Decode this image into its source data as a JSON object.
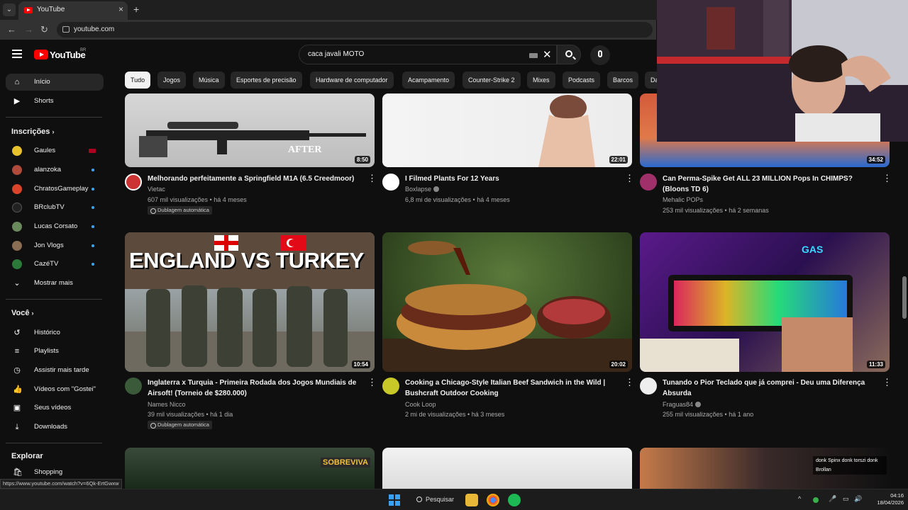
{
  "browser": {
    "tab_title": "YouTube",
    "url": "youtube.com",
    "status_url": "https://www.youtube.com/watch?v=6Qk-ErtGwxw"
  },
  "header": {
    "logo_text": "YouTube",
    "country": "BR",
    "search_value": "caca javali MOTO"
  },
  "sidebar": {
    "main": [
      {
        "label": "Início",
        "icon": "home-icon"
      },
      {
        "label": "Shorts",
        "icon": "shorts-icon"
      }
    ],
    "subs_title": "Inscrições",
    "subs": [
      {
        "label": "Gaules",
        "color": "#e8c22b"
      },
      {
        "label": "alanzoka",
        "color": "#b04a3a"
      },
      {
        "label": "ChratosGameplay",
        "color": "#d9442b"
      },
      {
        "label": "BRclubTV",
        "color": "#222222"
      },
      {
        "label": "Lucas Corsato",
        "color": "#6b8a5c"
      },
      {
        "label": "Jon Vlogs",
        "color": "#8a6d55"
      },
      {
        "label": "CazéTV",
        "color": "#2c7a3a"
      }
    ],
    "show_more": "Mostrar mais",
    "you_title": "Você",
    "you": [
      {
        "label": "Histórico",
        "icon": "history-icon"
      },
      {
        "label": "Playlists",
        "icon": "playlists-icon"
      },
      {
        "label": "Assistir mais tarde",
        "icon": "watch-later-icon"
      },
      {
        "label": "Vídeos com \"Gostei\"",
        "icon": "like-icon"
      },
      {
        "label": "Seus vídeos",
        "icon": "your-videos-icon"
      },
      {
        "label": "Downloads",
        "icon": "download-icon"
      }
    ],
    "explore_title": "Explorar",
    "explore": [
      {
        "label": "Shopping",
        "icon": "shopping-icon"
      }
    ]
  },
  "chips": [
    "Tudo",
    "Jogos",
    "Música",
    "Esportes de precisão",
    "Hardware de computador",
    "Acampamento",
    "Counter-Strike 2",
    "Mixes",
    "Podcasts",
    "Barcos",
    "Da"
  ],
  "videos": [
    {
      "title": "Melhorando perfeitamente a Springfield M1A (6.5 Creedmoor)",
      "channel": "Vietac",
      "meta": "607 mil visualizações • há 4 meses",
      "duration": "8:50",
      "dubbed": "Dublagem automática",
      "thumb_text": "AFTER"
    },
    {
      "title": "I Filmed Plants For 12 Years",
      "channel": "Boxlapse",
      "meta": "6,8 mi de visualizações • há 4 meses",
      "duration": "22:01",
      "dubbed": "",
      "thumb_text": ""
    },
    {
      "title": "Can Perma-Spike Get ALL 23 MILLION Pops In CHIMPS? (Bloons TD 6)",
      "channel": "Mehalic POPs",
      "meta": "253 mil visualizações • há 2 semanas",
      "duration": "34:52",
      "dubbed": "",
      "thumb_text": ""
    },
    {
      "title": "Inglaterra x Turquia - Primeira Rodada dos Jogos Mundiais de Airsoft! (Torneio de $280.000)",
      "channel": "Names Nicco",
      "meta": "39 mil visualizações • há 1 dia",
      "duration": "10:54",
      "dubbed": "Dublagem automática",
      "thumb_text": "ENGLAND VS TURKEY"
    },
    {
      "title": "Cooking a Chicago-Style Italian Beef Sandwich in the Wild | Bushcraft Outdoor Cooking",
      "channel": "Cook Loop",
      "meta": "2 mi de visualizações • há 3 meses",
      "duration": "20:02",
      "dubbed": "",
      "thumb_text": ""
    },
    {
      "title": "Tunando o Pior Teclado que já comprei - Deu uma Diferença Absurda",
      "channel": "Fraguas84",
      "meta": "255 mil visualizações • há 1 ano",
      "duration": "11:33",
      "dubbed": "",
      "thumb_text": "GAS"
    },
    {
      "title": "",
      "channel": "",
      "meta": "",
      "duration": "",
      "dubbed": "",
      "thumb_text": "SOBREVIVA"
    },
    {
      "title": "",
      "channel": "",
      "meta": "",
      "duration": "",
      "dubbed": "",
      "thumb_text": ""
    },
    {
      "title": "",
      "channel": "",
      "meta": "",
      "duration": "",
      "dubbed": "",
      "thumb_text": "donk Spinx donk torszi donk Brollan"
    }
  ],
  "taskbar": {
    "search": "Pesquisar",
    "time": "04:16",
    "date": "18/04/2026"
  }
}
